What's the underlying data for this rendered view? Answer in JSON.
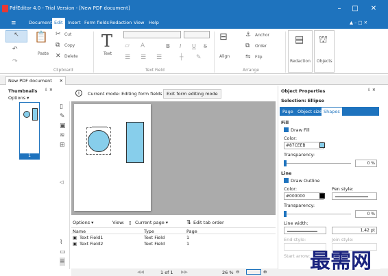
{
  "window": {
    "title": "PdfEditor 4.0 - Trial Version - [New PDF document]",
    "minimize": "–",
    "maximize": "□",
    "close": "✕"
  },
  "menu": {
    "items": [
      "Document",
      "Edit",
      "Insert",
      "Form fields",
      "Redaction",
      "View",
      "Help"
    ],
    "right": "▲ – □ ✕"
  },
  "ribbon": {
    "paste": "Paste",
    "cut": "Cut",
    "copy": "Copy",
    "delete": "Delete",
    "clipboard_group": "Clipboard",
    "text": "Text",
    "textfield_group": "Text Field",
    "align": "Align",
    "anchor": "Anchor",
    "order": "Order",
    "flip": "Flip",
    "arrange_group": "Arrange",
    "redaction": "Redaction",
    "objects": "Objects",
    "bold": "B",
    "italic": "I",
    "underline": "U",
    "strike": "S"
  },
  "tabs": {
    "doc": "New PDF document",
    "close": "✕"
  },
  "thumbnails": {
    "title": "Thumbnails",
    "options": "Options ▾",
    "page_num": "1"
  },
  "mode": {
    "text": "Current mode: Editing form fields",
    "button": "Exit form editing mode"
  },
  "formlist": {
    "options": "Options ▾",
    "view_label": "View:",
    "view_value": "Current page ▾",
    "edit_order": "Edit tab order",
    "headers": [
      "Name",
      "Type",
      "Page"
    ],
    "rows": [
      [
        "Text Field1",
        "Text Field",
        "1"
      ],
      [
        "Text Field2",
        "Text Field",
        "1"
      ]
    ]
  },
  "statusbar": {
    "page": "1 of 1",
    "zoom": "26 %"
  },
  "props": {
    "title": "Object Properties",
    "selection": "Selection: Ellipse",
    "tabs": [
      "Page",
      "Object size",
      "Shapes"
    ],
    "fill_header": "Fill",
    "draw_fill": "Draw Fill",
    "color_label": "Color:",
    "fill_color": "#87CEEB",
    "transparency": "Transparency:",
    "fill_transparency": "0 %",
    "line_header": "Line",
    "draw_outline": "Draw Outline",
    "line_color": "#000000",
    "pen_style": "Pen style:",
    "line_transparency": "0 %",
    "line_width": "Line width:",
    "line_width_value": "1.42 pt",
    "end_style": "End style:",
    "join_style": "Join style:",
    "start_arrow": "Start arrow:"
  },
  "watermark": "最需网",
  "colors": {
    "accent": "#1e73be",
    "fill": "#87CEEB"
  }
}
